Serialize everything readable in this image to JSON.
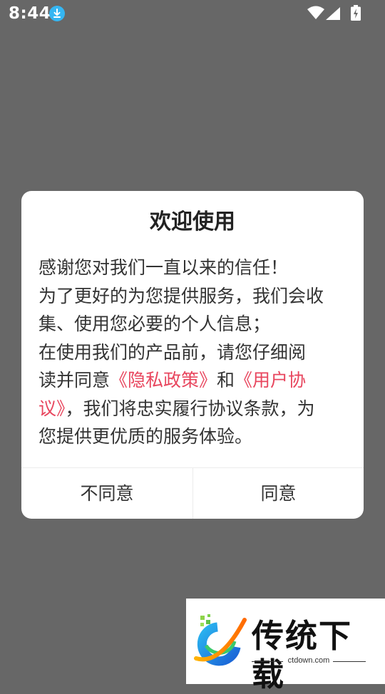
{
  "status_bar": {
    "time": "8:44",
    "icons": [
      "download-icon",
      "wifi-icon",
      "signal-icon",
      "battery-icon"
    ]
  },
  "dialog": {
    "title": "欢迎使用",
    "body": {
      "line1": "感谢您对我们一直以来的信任！",
      "line2": "为了更好的为您提供服务，我们会收",
      "line3": "集、使用您必要的个人信息；",
      "line4": "在使用我们的产品前，请您仔细阅",
      "line5_a": "读并同意",
      "privacy_link": "《隐私政策》",
      "line5_b": "和",
      "agreement_link_part1": "《用户协",
      "agreement_link_part2": "议》",
      "line6_b": "，我们将忠实履行协议条款，为",
      "line7": "您提供更优质的服务体验。"
    },
    "disagree_label": "不同意",
    "agree_label": "同意"
  },
  "watermark": {
    "title": "传统下载",
    "domain": "ctdown.com"
  },
  "colors": {
    "overlay": "#676767",
    "link": "#e8465e",
    "download_badge": "#35b6f2"
  }
}
